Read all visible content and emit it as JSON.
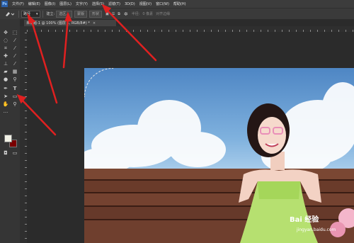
{
  "app": {
    "logo": "Ps"
  },
  "menubar": {
    "items": [
      "文件(F)",
      "编辑(E)",
      "图像(I)",
      "图层(L)",
      "文字(Y)",
      "选择(S)",
      "滤镜(T)",
      "3D(D)",
      "视图(V)",
      "窗口(W)",
      "帮助(H)"
    ]
  },
  "options": {
    "mode_value": "路径",
    "build_label": "建立:",
    "selection_button": "选区...",
    "mask_button": "蒙版",
    "shape_button": "形状",
    "radius_label": "半径:",
    "radius_value": "0 像素",
    "align_edges": "对齐边缘"
  },
  "document": {
    "tab_title": "未标题-1 @ 100% (图层 1, RGB/8#) *",
    "close": "×"
  },
  "colors": {
    "foreground": "#f2f2e6",
    "background": "#7a0000",
    "annotation_arrow": "#e02020"
  },
  "watermark": {
    "brand": "Bai 经验",
    "url": "jingyan.baidu.com"
  },
  "icons": [
    "move-icon",
    "marquee-icon",
    "lasso-icon",
    "quick-select-icon",
    "crop-icon",
    "eyedropper-icon",
    "healing-icon",
    "brush-icon",
    "stamp-icon",
    "history-brush-icon",
    "eraser-icon",
    "gradient-icon",
    "blur-icon",
    "dodge-icon",
    "pen-icon",
    "type-icon",
    "path-select-icon",
    "shape-icon",
    "hand-icon",
    "zoom-icon",
    "more-icon"
  ]
}
